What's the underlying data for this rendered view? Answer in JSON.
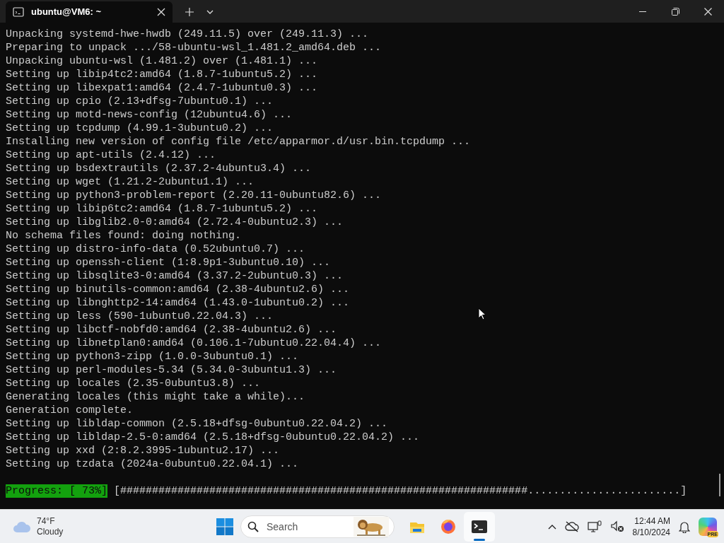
{
  "window": {
    "title": "ubuntu@VM6: ~"
  },
  "terminal": {
    "lines": [
      "Unpacking systemd-hwe-hwdb (249.11.5) over (249.11.3) ...",
      "Preparing to unpack .../58-ubuntu-wsl_1.481.2_amd64.deb ...",
      "Unpacking ubuntu-wsl (1.481.2) over (1.481.1) ...",
      "Setting up libip4tc2:amd64 (1.8.7-1ubuntu5.2) ...",
      "Setting up libexpat1:amd64 (2.4.7-1ubuntu0.3) ...",
      "Setting up cpio (2.13+dfsg-7ubuntu0.1) ...",
      "Setting up motd-news-config (12ubuntu4.6) ...",
      "Setting up tcpdump (4.99.1-3ubuntu0.2) ...",
      "Installing new version of config file /etc/apparmor.d/usr.bin.tcpdump ...",
      "Setting up apt-utils (2.4.12) ...",
      "Setting up bsdextrautils (2.37.2-4ubuntu3.4) ...",
      "Setting up wget (1.21.2-2ubuntu1.1) ...",
      "Setting up python3-problem-report (2.20.11-0ubuntu82.6) ...",
      "Setting up libip6tc2:amd64 (1.8.7-1ubuntu5.2) ...",
      "Setting up libglib2.0-0:amd64 (2.72.4-0ubuntu2.3) ...",
      "No schema files found: doing nothing.",
      "Setting up distro-info-data (0.52ubuntu0.7) ...",
      "Setting up openssh-client (1:8.9p1-3ubuntu0.10) ...",
      "Setting up libsqlite3-0:amd64 (3.37.2-2ubuntu0.3) ...",
      "Setting up binutils-common:amd64 (2.38-4ubuntu2.6) ...",
      "Setting up libnghttp2-14:amd64 (1.43.0-1ubuntu0.2) ...",
      "Setting up less (590-1ubuntu0.22.04.3) ...",
      "Setting up libctf-nobfd0:amd64 (2.38-4ubuntu2.6) ...",
      "Setting up libnetplan0:amd64 (0.106.1-7ubuntu0.22.04.4) ...",
      "Setting up python3-zipp (1.0.0-3ubuntu0.1) ...",
      "Setting up perl-modules-5.34 (5.34.0-3ubuntu1.3) ...",
      "Setting up locales (2.35-0ubuntu3.8) ...",
      "Generating locales (this might take a while)...",
      "Generation complete.",
      "Setting up libldap-common (2.5.18+dfsg-0ubuntu0.22.04.2) ...",
      "Setting up libldap-2.5-0:amd64 (2.5.18+dfsg-0ubuntu0.22.04.2) ...",
      "Setting up xxd (2:8.2.3995-1ubuntu2.17) ...",
      "Setting up tzdata (2024a-0ubuntu0.22.04.1) ..."
    ],
    "progress": {
      "label": "Progress: [ 73%]",
      "bar": "[################################################################........................]"
    }
  },
  "taskbar": {
    "weather": {
      "temperature": "74°F",
      "condition": "Cloudy"
    },
    "search": {
      "placeholder": "Search"
    },
    "apps": [
      {
        "kind": "files",
        "selected": false
      },
      {
        "kind": "firefox",
        "selected": false
      },
      {
        "kind": "terminal",
        "selected": true
      }
    ],
    "time": "12:44 AM",
    "date": "8/10/2024",
    "copilot_badge": "PRE"
  }
}
